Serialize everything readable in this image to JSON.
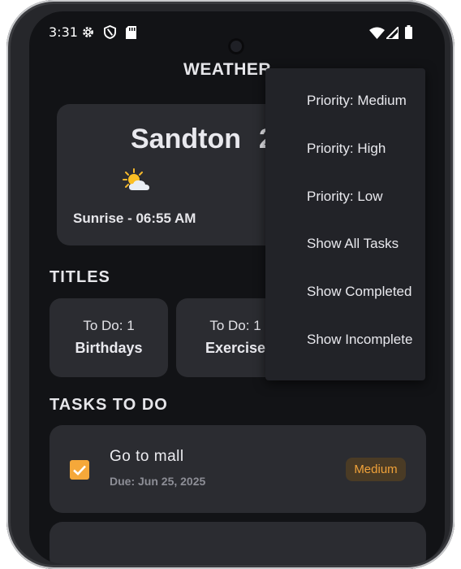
{
  "status_bar": {
    "time": "3:31",
    "left_icons": [
      "gear-icon",
      "shield-icon",
      "sd-card-icon"
    ],
    "right_icons": [
      "wifi-icon",
      "signal-icon",
      "battery-icon"
    ]
  },
  "header": {
    "title": "WEATHER"
  },
  "weather": {
    "city": "Sandton",
    "temperature_partial": "2",
    "icon": "sun-behind-cloud-icon",
    "sunrise": "Sunrise - 06:55 AM"
  },
  "titles_section": {
    "heading": "TITLES",
    "cards": [
      {
        "todo": "To Do: 1",
        "name": "Birthdays"
      },
      {
        "todo": "To Do: 1",
        "name": "Exercise"
      }
    ]
  },
  "tasks_section": {
    "heading": "TASKS TO DO",
    "tasks": [
      {
        "name": "Go to mall",
        "due": "Due: Jun 25, 2025",
        "priority": "Medium",
        "completed": true
      }
    ]
  },
  "filter_menu": {
    "items": [
      {
        "label": "Priority: Medium"
      },
      {
        "label": "Priority: High"
      },
      {
        "label": "Priority: Low"
      },
      {
        "label": "Show All Tasks"
      },
      {
        "label": "Show Completed"
      },
      {
        "label": "Show Incomplete"
      }
    ]
  },
  "colors": {
    "background": "#121316",
    "card": "#2b2c31",
    "menu": "#222328",
    "accent_orange": "#f5a83a",
    "badge_bg": "#4a3b25",
    "badge_text": "#f0a23a"
  }
}
